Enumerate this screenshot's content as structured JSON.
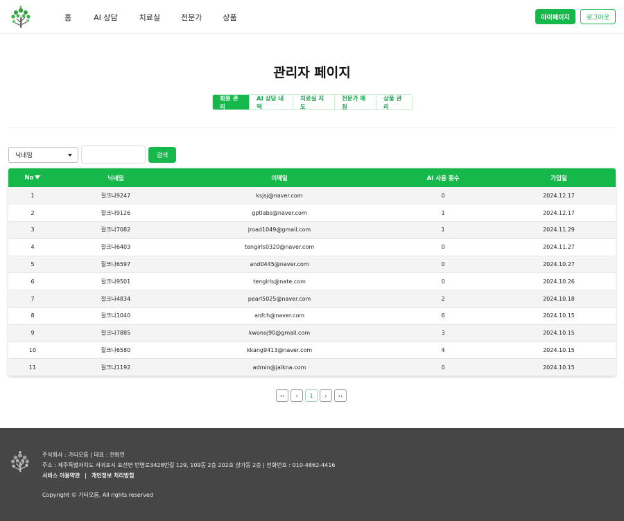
{
  "header": {
    "logo_icon": "tree-logo-icon",
    "nav": [
      "홈",
      "AI 상담",
      "치료실",
      "전문가",
      "상품"
    ],
    "mypage_label": "마이페이지",
    "logout_label": "로그아웃"
  },
  "page": {
    "title": "관리자 페이지",
    "tabs": [
      "회원 관리",
      "AI 상담 내역",
      "치료실 지도",
      "전문가 매칭",
      "상품 관리"
    ],
    "active_tab": "회원 관리"
  },
  "search": {
    "select_value": "닉네임",
    "input_value": "",
    "button_label": "검색"
  },
  "table": {
    "columns": [
      "No",
      "닉네임",
      "이메일",
      "AI 사용 횟수",
      "가입일"
    ],
    "rows": [
      [
        "1",
        "잘크나9247",
        "ksjsj@naver.com",
        "0",
        "2024.12.17"
      ],
      [
        "2",
        "잘크나9126",
        "gptlabs@naver.com",
        "1",
        "2024.12.17"
      ],
      [
        "3",
        "잘크나7082",
        "jroad1049@gmail.com",
        "1",
        "2024.11.29"
      ],
      [
        "4",
        "잘크나6403",
        "tengirls0320@naver.com",
        "0",
        "2024.11.27"
      ],
      [
        "5",
        "잘크나6597",
        "and0445@naver.com",
        "0",
        "2024.10.27"
      ],
      [
        "6",
        "잘크나9501",
        "tengirls@nate.com",
        "0",
        "2024.10.26"
      ],
      [
        "7",
        "잘크나4834",
        "pearl5025@naver.com",
        "2",
        "2024.10.18"
      ],
      [
        "8",
        "잘크나1040",
        "anfch@naver.com",
        "6",
        "2024.10.15"
      ],
      [
        "9",
        "잘크나7885",
        "kwonoj90@gmail.com",
        "3",
        "2024.10.15"
      ],
      [
        "10",
        "잘크나6580",
        "kkang9413@naver.com",
        "4",
        "2024.10.15"
      ],
      [
        "11",
        "잘크나1192",
        "admin@jalkna.com",
        "0",
        "2024.10.15"
      ]
    ]
  },
  "pagination": {
    "first": "‹‹",
    "prev": "‹",
    "current": "1",
    "next": "›",
    "last": "››"
  },
  "footer": {
    "company_line": "주식회사 : 가티오름  |  대표 : 전화연",
    "address_line": "주소 : 제주특별자치도 서귀포시 표선면 번영로3428번길 129, 109동 2층 202호 상가동 2층  |  전화번호 : 010-4862-4416",
    "terms_label": "서비스 이용약관",
    "separator": "|",
    "privacy_label": "개인정보 처리방침",
    "copyright": "Copyright © 가티오름. All rights reserved"
  },
  "colors": {
    "accent": "#16b84c",
    "footer_bg": "#464646"
  }
}
